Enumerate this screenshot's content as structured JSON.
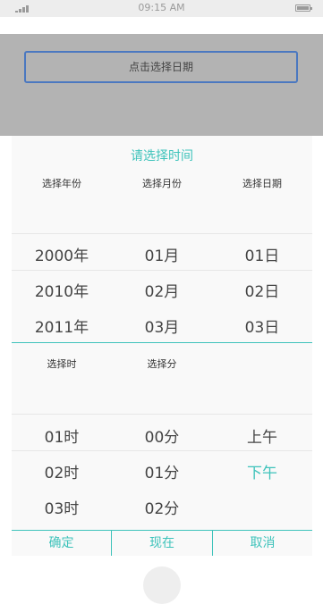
{
  "status_bar": {
    "time": "09:15 AM",
    "icons": [
      "signal-icon",
      "battery-icon"
    ]
  },
  "date_input": {
    "placeholder": "点击选择日期"
  },
  "picker": {
    "title": "请选择时间",
    "date_headers": [
      "选择年份",
      "选择月份",
      "选择日期"
    ],
    "years": [
      "2000年",
      "2010年",
      "2011年"
    ],
    "months": [
      "01月",
      "02月",
      "03月"
    ],
    "days": [
      "01日",
      "02日",
      "03日"
    ],
    "time_headers": [
      "选择时",
      "选择分"
    ],
    "hours": [
      "01时",
      "02时",
      "03时"
    ],
    "minutes": [
      "00分",
      "01分",
      "02分"
    ],
    "ampm": [
      "上午",
      "下午"
    ],
    "ampm_selected": "下午"
  },
  "footer": {
    "confirm": "确定",
    "now": "现在",
    "cancel": "取消"
  },
  "colors": {
    "accent": "#3fc3bb",
    "border": "#4b78c0",
    "overlay": "#b3b3b3"
  }
}
